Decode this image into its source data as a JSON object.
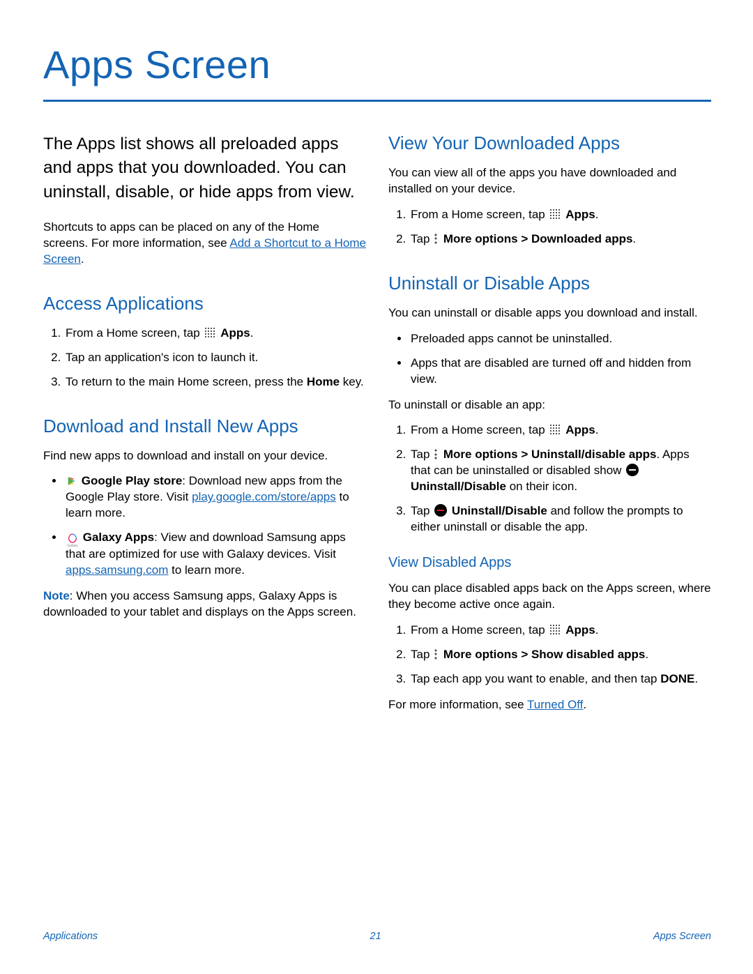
{
  "page": {
    "title": "Apps Screen",
    "intro": "The Apps list shows all preloaded apps and apps that you downloaded. You can uninstall, disable, or hide apps from view.",
    "shortcuts_para_prefix": "Shortcuts to apps can be placed on any of the Home screens. For more information, see ",
    "shortcuts_link": "Add a Shortcut to a Home Screen",
    "period": "."
  },
  "footer": {
    "left": "Applications",
    "center": "21",
    "right": "Apps Screen"
  },
  "sections": {
    "access": {
      "heading": "Access Applications",
      "step1_prefix": "From a Home screen, tap ",
      "step1_bold": "Apps",
      "step2": "Tap an application's icon to launch it.",
      "step3_prefix": "To return to the main Home screen, press the ",
      "step3_bold": "Home",
      "step3_suffix": " key."
    },
    "download": {
      "heading": "Download and Install New Apps",
      "intro": "Find new apps to download and install on your device.",
      "bullet1_bold": "Google Play store",
      "bullet1_text": ": Download new apps from the Google Play store. Visit ",
      "bullet1_link": "play.google.com/store/apps",
      "bullet1_suffix": " to learn more.",
      "bullet2_bold": "Galaxy Apps",
      "bullet2_text": ": View and download Samsung apps that are optimized for use with Galaxy devices. Visit ",
      "bullet2_link": "apps.samsung.com",
      "bullet2_suffix": " to learn more.",
      "note_label": "Note",
      "note_text": ": When you access Samsung apps, Galaxy Apps is downloaded to your tablet and displays on the Apps screen."
    },
    "view_downloaded": {
      "heading": "View Your Downloaded Apps",
      "intro": "You can view all of the apps you have downloaded and installed on your device.",
      "step1_prefix": "From a Home screen, tap ",
      "step1_bold": "Apps",
      "step2_prefix": "Tap ",
      "step2_bold": "More options > Downloaded apps"
    },
    "uninstall": {
      "heading": "Uninstall or Disable Apps",
      "intro": "You can uninstall or disable apps you download and install.",
      "bullet1": "Preloaded apps cannot be uninstalled.",
      "bullet2": "Apps that are disabled are turned off and hidden from view.",
      "subintro": "To uninstall or disable an app:",
      "step1_prefix": "From a Home screen, tap ",
      "step1_bold": "Apps",
      "step2_prefix": "Tap ",
      "step2_bold": "More options > Uninstall/disable apps",
      "step2_text": ". Apps that can be uninstalled or disabled show ",
      "step2_bold2": "Uninstall/Disable",
      "step2_suffix": " on their icon.",
      "step3_prefix": "Tap ",
      "step3_bold": "Uninstall/Disable",
      "step3_suffix": " and follow the prompts to either uninstall or disable the app."
    },
    "view_disabled": {
      "heading": "View Disabled Apps",
      "intro": "You can place disabled apps back on the Apps screen, where they become active once again.",
      "step1_prefix": "From a Home screen, tap ",
      "step1_bold": "Apps",
      "step2_prefix": "Tap ",
      "step2_bold": "More options > Show disabled apps",
      "step3_prefix": "Tap each app you want to enable, and then tap ",
      "step3_bold": "DONE",
      "outro_prefix": "For more information, see ",
      "outro_link": "Turned Off"
    }
  },
  "icons": {
    "apps": "apps-grid-icon",
    "more": "more-options-icon",
    "minus": "uninstall-disable-icon",
    "play": "google-play-icon",
    "galaxy": "galaxy-apps-icon",
    "galaxy_label": "Galaxy"
  }
}
